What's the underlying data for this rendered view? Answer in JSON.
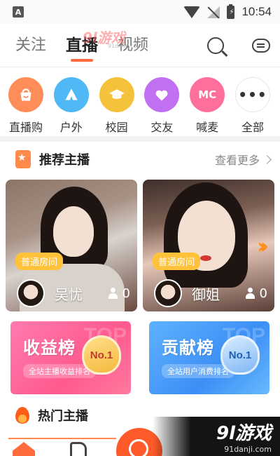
{
  "status_bar": {
    "notification_letter": "A",
    "time": "10:54"
  },
  "watermark_top": {
    "main": "9l游戏",
    "url": "91danji.com"
  },
  "nav": {
    "tabs": [
      {
        "label": "关注",
        "active": false
      },
      {
        "label": "直播",
        "active": true
      },
      {
        "label": "视频",
        "active": false
      }
    ]
  },
  "categories": [
    {
      "label": "直播购",
      "icon": "shopping-bag-icon",
      "color": "#ff8d5a"
    },
    {
      "label": "户外",
      "icon": "tent-icon",
      "color": "#4fb8f5"
    },
    {
      "label": "校园",
      "icon": "graduation-cap-icon",
      "color": "#f5c23b"
    },
    {
      "label": "交友",
      "icon": "hearts-icon",
      "color": "#c070f0"
    },
    {
      "label": "喊麦",
      "icon": "mc-icon",
      "icon_text": "MC",
      "color": "#ff6f9c"
    },
    {
      "label": "全部",
      "icon": "more-dots-icon",
      "color": "#ffffff"
    }
  ],
  "recommended": {
    "title": "推荐主播",
    "more": "查看更多",
    "streamers": [
      {
        "name": "吴忧",
        "tag": "普通房间",
        "viewers": "0"
      },
      {
        "name": "御姐",
        "tag": "普通房间",
        "viewers": "0"
      }
    ]
  },
  "rankings": [
    {
      "title": "收益榜",
      "subtitle": "全站主播收益排名",
      "bg_text": "TOP",
      "badge": "No.1"
    },
    {
      "title": "贡献榜",
      "subtitle": "全站用户消费排名",
      "bg_text": "TOP",
      "badge": "No.1"
    }
  ],
  "hot": {
    "title": "热门主播"
  },
  "watermark_bottom": {
    "main": "9l游戏",
    "url": "91danji.com"
  }
}
